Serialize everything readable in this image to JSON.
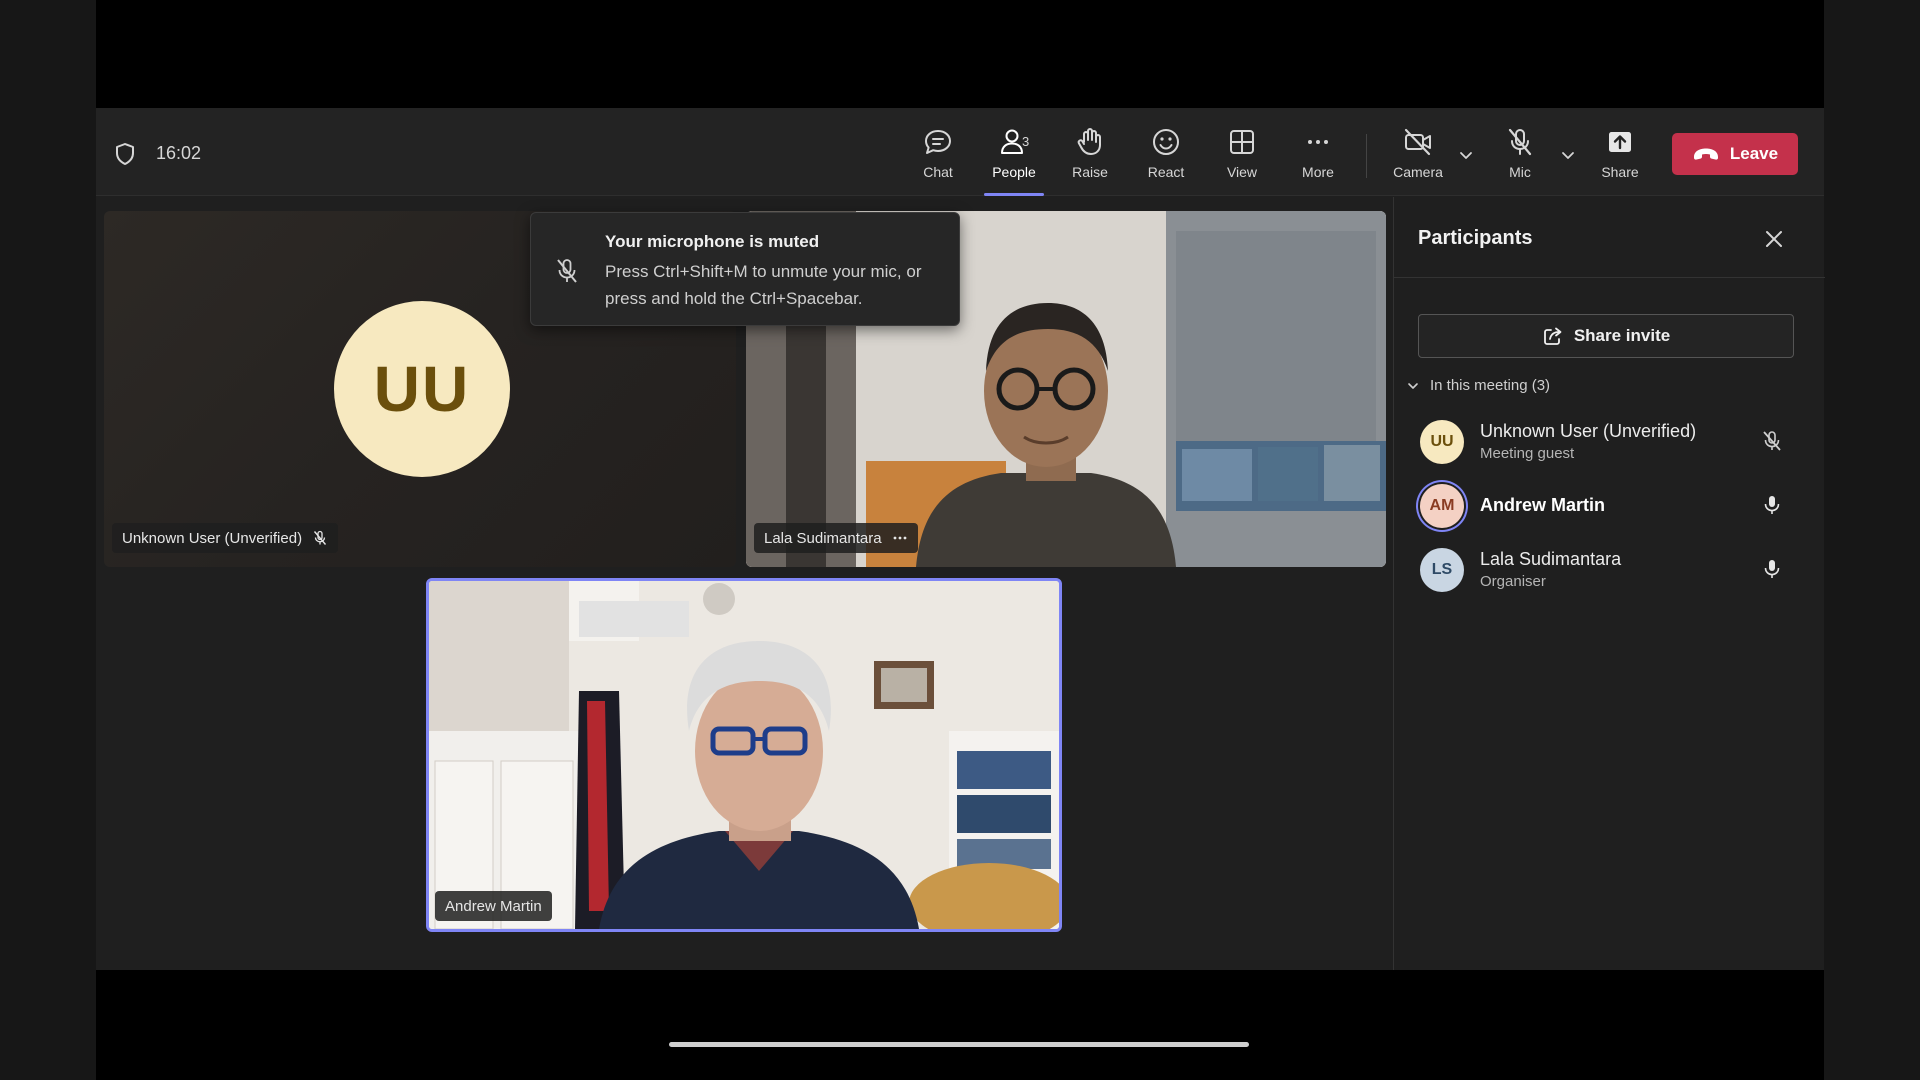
{
  "meeting": {
    "timer": "16:02"
  },
  "toolbar": {
    "chat_label": "Chat",
    "people_label": "People",
    "people_count": "3",
    "raise_label": "Raise",
    "react_label": "React",
    "view_label": "View",
    "more_label": "More",
    "camera_label": "Camera",
    "mic_label": "Mic",
    "share_label": "Share",
    "leave_label": "Leave"
  },
  "stage": {
    "tiles": [
      {
        "name": "Unknown User (Unverified)",
        "initials": "UU",
        "mic": "muted"
      },
      {
        "name": "Lala Sudimantara",
        "video": true
      },
      {
        "name": "Andrew Martin",
        "video": true,
        "active_speaker": true
      }
    ]
  },
  "toast": {
    "title": "Your microphone is muted",
    "body": "Press Ctrl+Shift+M to unmute your mic, or press and hold the Ctrl+Spacebar."
  },
  "panel": {
    "title": "Participants",
    "share_invite_label": "Share invite",
    "section_label": "In this meeting (3)",
    "participants": [
      {
        "initials": "UU",
        "name": "Unknown User (Unverified)",
        "role": "Meeting guest",
        "mic": "muted"
      },
      {
        "initials": "AM",
        "name": "Andrew Martin",
        "role": "",
        "mic": "on"
      },
      {
        "initials": "LS",
        "name": "Lala Sudimantara",
        "role": "Organiser",
        "mic": "on"
      }
    ]
  },
  "colors": {
    "accent": "#7f85f5",
    "leave": "#c4314b",
    "avatar_uu": "#f7e9c0",
    "avatar_am": "#f4d1c4",
    "avatar_ls": "#c9d6e3"
  },
  "icons": {
    "shield": "shield-icon",
    "chat": "chat-icon",
    "people": "people-icon",
    "raise": "hand-icon",
    "react": "smiley-icon",
    "view": "grid-icon",
    "more": "ellipsis-icon",
    "camera": "camera-off-icon",
    "mic": "mic-off-icon",
    "share": "share-tray-icon",
    "leave": "phone-hangup-icon",
    "close": "close-icon"
  }
}
